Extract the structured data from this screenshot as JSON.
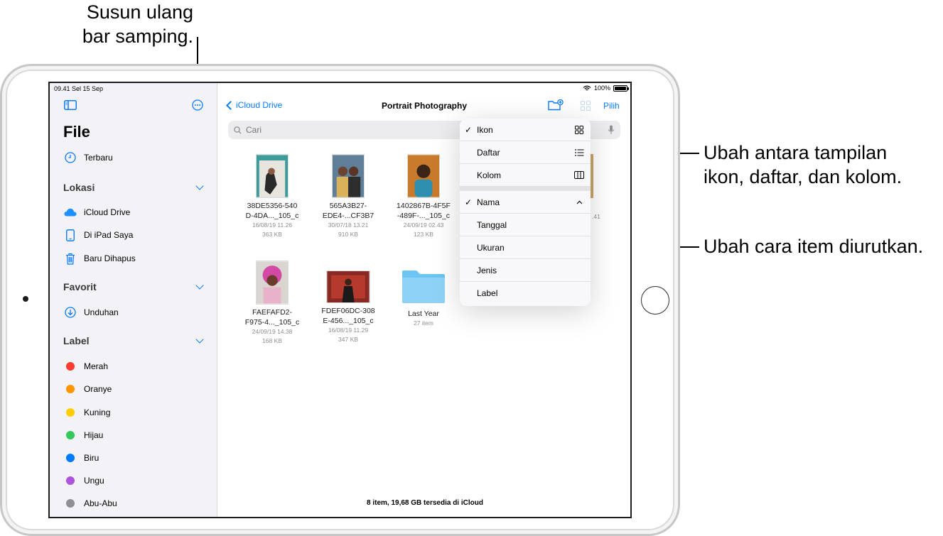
{
  "callouts": {
    "sidebar_line1": "Susun ulang",
    "sidebar_line2": "bar samping.",
    "view_line1": "Ubah antara tampilan",
    "view_line2": "ikon, daftar, dan kolom.",
    "sort": "Ubah cara item diurutkan."
  },
  "status_bar": {
    "time": "09.41  Sel 15 Sep",
    "battery": "100%"
  },
  "sidebar": {
    "title": "File",
    "recents": "Terbaru",
    "sections": {
      "locations": "Lokasi",
      "favorites": "Favorit",
      "tags": "Label"
    },
    "locations": [
      "iCloud Drive",
      "Di iPad Saya",
      "Baru Dihapus"
    ],
    "favorites": [
      "Unduhan"
    ],
    "tags": [
      {
        "label": "Merah",
        "color": "#ff3b30"
      },
      {
        "label": "Oranye",
        "color": "#ff9500"
      },
      {
        "label": "Kuning",
        "color": "#ffcc00"
      },
      {
        "label": "Hijau",
        "color": "#34c759"
      },
      {
        "label": "Biru",
        "color": "#007aff"
      },
      {
        "label": "Ungu",
        "color": "#af52de"
      },
      {
        "label": "Abu-Abu",
        "color": "#8e8e93"
      }
    ]
  },
  "nav": {
    "back": "iCloud Drive",
    "title": "Portrait Photography",
    "select": "Pilih",
    "accent": "#0a7aff"
  },
  "search": {
    "placeholder": "Cari"
  },
  "files": [
    {
      "name1": "38DE5356-540",
      "name2": "D-4DA..._105_c",
      "date": "16/08/19 11.26",
      "size": "363 KB"
    },
    {
      "name1": "565A3B27-",
      "name2": "EDE4-...CF3B7",
      "date": "30/07/18 13.21",
      "size": "910 KB"
    },
    {
      "name1": "1402867B-4F5F",
      "name2": "-489F-..._105_c",
      "date": "24/09/19 02.43",
      "size": "123 KB"
    },
    {
      "name1": "FAEFAFD2-",
      "name2": "F975-4..._105_c",
      "date": "24/09/19 14.38",
      "size": "168 KB"
    },
    {
      "name1": "FDEF06DC-308",
      "name2": "E-456..._105_c",
      "date": "16/08/19 11.29",
      "size": "347 KB"
    },
    {
      "name1": "Last Year",
      "name2": "",
      "date": "27 item",
      "size": ""
    }
  ],
  "partial_meta": ".41",
  "footer": "8 item, 19,68 GB tersedia di iCloud",
  "menu": {
    "view": [
      {
        "label": "Ikon",
        "checked": "✓",
        "icon": "grid-icon"
      },
      {
        "label": "Daftar",
        "checked": "",
        "icon": "list-icon"
      },
      {
        "label": "Kolom",
        "checked": "",
        "icon": "columns-icon"
      }
    ],
    "sort": [
      {
        "label": "Nama",
        "checked": "✓"
      },
      {
        "label": "Tanggal",
        "checked": ""
      },
      {
        "label": "Ukuran",
        "checked": ""
      },
      {
        "label": "Jenis",
        "checked": ""
      },
      {
        "label": "Label",
        "checked": ""
      }
    ]
  }
}
